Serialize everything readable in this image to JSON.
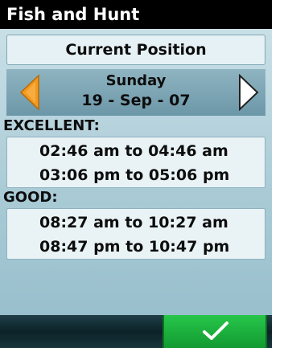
{
  "title": "Fish and Hunt",
  "current_position_label": "Current Position",
  "date": {
    "day": "Sunday",
    "date": "19 - Sep - 07",
    "prev_icon": "chevron-left-orange",
    "next_icon": "chevron-right-white"
  },
  "excellent": {
    "label": "EXCELLENT:",
    "times": [
      "02:46  am to 04:46  am",
      "03:06  pm to 05:06  pm"
    ]
  },
  "good": {
    "label": "GOOD:",
    "times": [
      "08:27  am to 10:27  am",
      "08:47  pm to 10:47  pm"
    ]
  },
  "ok_button_icon": "checkmark",
  "colors": {
    "title_bar": "#000000",
    "accent_orange": "#f39a1d",
    "ok_green": "#1fb03f"
  }
}
